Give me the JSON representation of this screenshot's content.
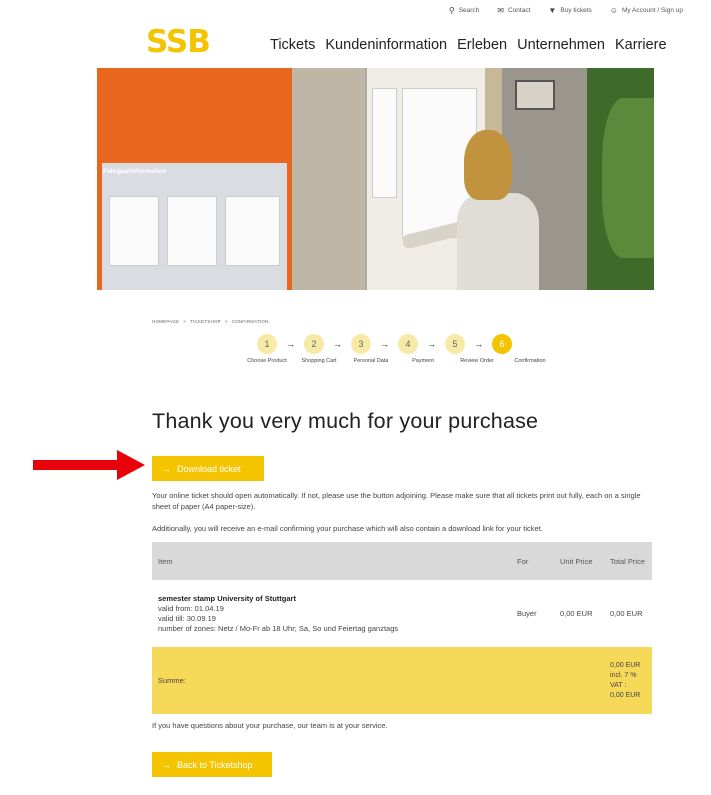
{
  "utility_bar": {
    "search": "Search",
    "contact": "Contact",
    "buy_tickets": "Buy tickets",
    "account": "My Account / Sign up"
  },
  "logo": "SSB",
  "nav": [
    "Tickets",
    "Kundeninformation",
    "Erleben",
    "Unternehmen",
    "Karriere"
  ],
  "hero": {
    "board_title": "Fahrgastinformation"
  },
  "breadcrumb": [
    "HOMEPAGE",
    "TICKETSHOP",
    "CONFIRMATION"
  ],
  "steps": [
    {
      "number": "1",
      "label": "Choose Product"
    },
    {
      "number": "2",
      "label": "Shopping Cart"
    },
    {
      "number": "3",
      "label": "Personal Data"
    },
    {
      "number": "4",
      "label": "Payment"
    },
    {
      "number": "5",
      "label": "Review Order"
    },
    {
      "number": "6",
      "label": "Confirmation"
    }
  ],
  "active_step": 6,
  "main": {
    "title": "Thank you very much for your purchase",
    "download_label": "Download ticket",
    "info_text": "Your online ticket should open automatically. If not, please use the button adjoining. Please make sure that all tickets print out fully, each on a single sheet of paper (A4 paper-size).",
    "email_text": "Additionally, you will receive an e-mail confirming your purchase which will also contain a download link for your ticket.",
    "questions_text": "If you have questions about your purchase, our team is at your service.",
    "back_label": "Back to Ticketshop"
  },
  "table": {
    "headers": {
      "item": "Item",
      "for": "For",
      "unit_price": "Unit Price",
      "total_price": "Total Price"
    },
    "row": {
      "name": "semester stamp University of Stuttgart",
      "valid_from": "valid from: 01.04.19",
      "valid_till": "valid till: 30.09.19",
      "zones": "number of zones: Netz / Mo-Fr ab 18 Uhr; Sa, So und Feiertag ganztags",
      "for": "Buyer",
      "unit_price": "0,00 EUR",
      "total_price": "0,00 EUR"
    },
    "sum": {
      "label": "Summe:",
      "total": "0,00 EUR",
      "vat_rate": "incl. 7 %",
      "vat_label": "VAT :",
      "vat_amount": "0,00 EUR"
    }
  },
  "colors": {
    "brand_yellow": "#f5c400",
    "sum_row": "#f7d95a",
    "arrow_red": "#e8000b"
  }
}
